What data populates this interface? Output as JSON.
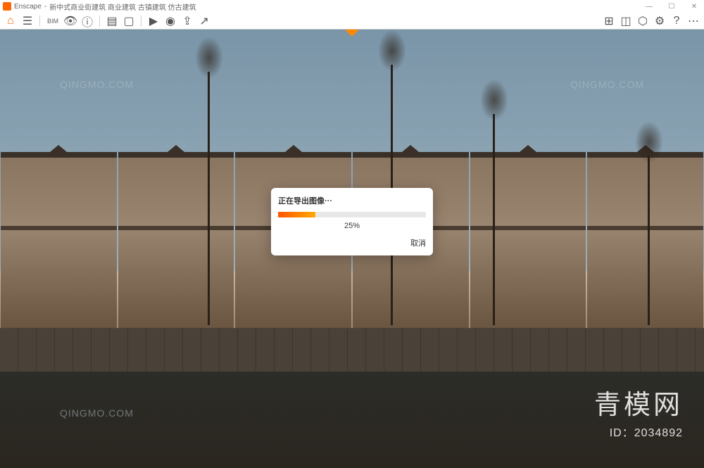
{
  "window": {
    "app_name": "Enscape",
    "document_title": "新中式商业街建筑 商业建筑 古镇建筑 仿古建筑",
    "title_separator": " - "
  },
  "window_controls": {
    "minimize": "—",
    "maximize": "☐",
    "close": "✕"
  },
  "toolbar": {
    "bim_label": "BIM",
    "icons_left": [
      {
        "name": "home-icon",
        "glyph": "⌂"
      },
      {
        "name": "menu-icon",
        "glyph": "☰"
      },
      {
        "name": "binoculars-icon",
        "glyph": "👁"
      },
      {
        "name": "info-icon",
        "glyph": "ⓘ"
      },
      {
        "name": "layers-icon",
        "glyph": "▤"
      },
      {
        "name": "box-icon",
        "glyph": "▢"
      },
      {
        "name": "video-icon",
        "glyph": "▶"
      },
      {
        "name": "panorama-icon",
        "glyph": "◉"
      },
      {
        "name": "export-icon",
        "glyph": "⇪"
      },
      {
        "name": "share-icon",
        "glyph": "↗"
      }
    ],
    "icons_right": [
      {
        "name": "map-icon",
        "glyph": "⊞"
      },
      {
        "name": "view-icon",
        "glyph": "◫"
      },
      {
        "name": "cube-icon",
        "glyph": "⬡"
      },
      {
        "name": "settings-icon",
        "glyph": "⚙"
      },
      {
        "name": "help-icon",
        "glyph": "?"
      },
      {
        "name": "more-icon",
        "glyph": "⋯"
      }
    ]
  },
  "dialog": {
    "title": "正在导出图像···",
    "progress_percent": 25,
    "progress_label": "25%",
    "cancel_label": "取消"
  },
  "watermarks": {
    "url": "QINGMO.COM",
    "brand_cn": "青模网",
    "id_label": "ID：2034892"
  }
}
